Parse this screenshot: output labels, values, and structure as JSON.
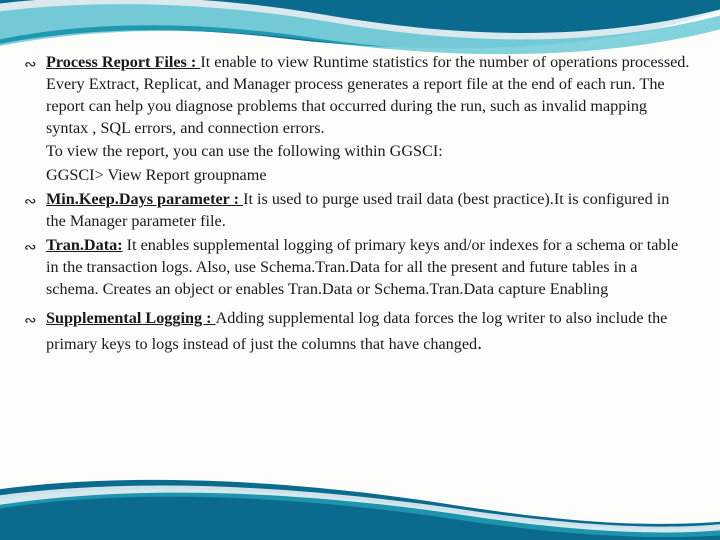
{
  "slide": {
    "items": [
      {
        "heading": "Process Report Files : ",
        "body": "It enable to view Runtime statistics for the number of operations processed. Every Extract, Replicat, and Manager process generates a report file at the end of each run. The report can help you diagnose problems that occurred during the run, such as invalid mapping syntax , SQL errors, and connection errors.",
        "sublines": [
          "To view the report, you can use the following within GGSCI:",
          "GGSCI> View Report groupname"
        ]
      },
      {
        "heading": " Min.Keep.Days parameter : ",
        "body": "It is used to purge used trail data (best practice).It is configured in the Manager  parameter file.",
        "sublines": []
      },
      {
        "heading": " Tran.Data:",
        "body": " It enables supplemental logging of primary keys and/or indexes for a schema or table in the transaction logs. Also, use Schema.Tran.Data for all the present and future tables in a schema. Creates an object or enables Tran.Data or Schema.Tran.Data capture Enabling",
        "sublines": []
      },
      {
        "heading": "Supplemental Logging : ",
        "body": "Adding supplemental log data forces the log writer to also include the primary keys to logs instead of just the columns that have changed",
        "sublines": []
      }
    ],
    "trailing_dot": "."
  },
  "icons": {
    "bullet": "∠"
  },
  "colors": {
    "swoosh_dark": "#0a6b8f",
    "swoosh_light": "#2fb6c7"
  }
}
